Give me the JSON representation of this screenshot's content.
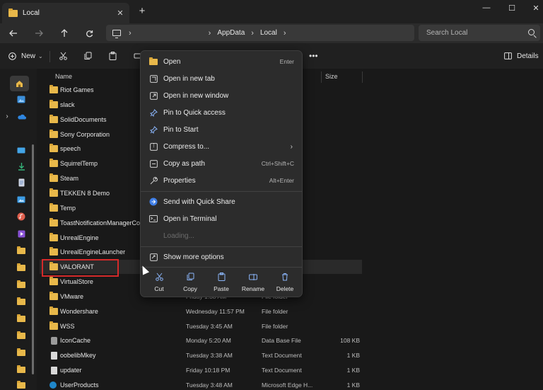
{
  "window": {
    "tab_title": "Local",
    "new_tab": "+",
    "minimize": "—",
    "maximize": "☐",
    "close": "✕"
  },
  "address": {
    "chevron_root": "›",
    "crumbs": [
      "AppData",
      "Local"
    ],
    "sep": "›",
    "search_placeholder": "Search Local"
  },
  "commandbar": {
    "new_label": "New",
    "details_label": "Details",
    "more": "•••"
  },
  "columns": {
    "name": "Name",
    "size": "Size"
  },
  "rows": [
    {
      "name": "Riot Games",
      "date": "",
      "type": "",
      "size": "",
      "icon": "folder"
    },
    {
      "name": "slack",
      "date": "",
      "type": "",
      "size": "",
      "icon": "folder"
    },
    {
      "name": "SolidDocuments",
      "date": "",
      "type": "",
      "size": "",
      "icon": "folder"
    },
    {
      "name": "Sony Corporation",
      "date": "",
      "type": "",
      "size": "",
      "icon": "folder"
    },
    {
      "name": "speech",
      "date": "",
      "type": "",
      "size": "",
      "icon": "folder"
    },
    {
      "name": "SquirrelTemp",
      "date": "",
      "type": "",
      "size": "",
      "icon": "folder"
    },
    {
      "name": "Steam",
      "date": "",
      "type": "",
      "size": "",
      "icon": "folder"
    },
    {
      "name": "TEKKEN 8 Demo",
      "date": "",
      "type": "",
      "size": "",
      "icon": "folder"
    },
    {
      "name": "Temp",
      "date": "",
      "type": "",
      "size": "",
      "icon": "folder"
    },
    {
      "name": "ToastNotificationManagerCo",
      "date": "",
      "type": "",
      "size": "",
      "icon": "folder"
    },
    {
      "name": "UnrealEngine",
      "date": "",
      "type": "",
      "size": "",
      "icon": "folder"
    },
    {
      "name": "UnrealEngineLauncher",
      "date": "",
      "type": "",
      "size": "",
      "icon": "folder"
    },
    {
      "name": "VALORANT",
      "date": "",
      "type": "",
      "size": "",
      "icon": "folder"
    },
    {
      "name": "VirtualStore",
      "date": "",
      "type": "",
      "size": "",
      "icon": "folder"
    },
    {
      "name": "VMware",
      "date": "Friday 1:38 AM",
      "type": "File folder",
      "size": "",
      "icon": "folder"
    },
    {
      "name": "Wondershare",
      "date": "Wednesday 11:57 PM",
      "type": "File folder",
      "size": "",
      "icon": "folder"
    },
    {
      "name": "WSS",
      "date": "Tuesday 3:45 AM",
      "type": "File folder",
      "size": "",
      "icon": "folder"
    },
    {
      "name": "IconCache",
      "date": "Monday 5:20 AM",
      "type": "Data Base File",
      "size": "108 KB",
      "icon": "db"
    },
    {
      "name": "oobelibMkey",
      "date": "Tuesday 3:38 AM",
      "type": "Text Document",
      "size": "1 KB",
      "icon": "file"
    },
    {
      "name": "updater",
      "date": "Friday 10:18 PM",
      "type": "Text Document",
      "size": "1 KB",
      "icon": "file"
    },
    {
      "name": "UserProducts",
      "date": "Tuesday 3:48 AM",
      "type": "Microsoft Edge H...",
      "size": "1 KB",
      "icon": "edge"
    }
  ],
  "context_menu": {
    "items": [
      {
        "label": "Open",
        "shortcut": "Enter"
      },
      {
        "label": "Open in new tab",
        "shortcut": ""
      },
      {
        "label": "Open in new window",
        "shortcut": ""
      },
      {
        "label": "Pin to Quick access",
        "shortcut": ""
      },
      {
        "label": "Pin to Start",
        "shortcut": ""
      },
      {
        "label": "Compress to...",
        "shortcut": "›"
      },
      {
        "label": "Copy as path",
        "shortcut": "Ctrl+Shift+C"
      },
      {
        "label": "Properties",
        "shortcut": "Alt+Enter"
      },
      {
        "label": "Send with Quick Share",
        "shortcut": ""
      },
      {
        "label": "Open in Terminal",
        "shortcut": ""
      },
      {
        "label": "Loading...",
        "shortcut": ""
      },
      {
        "label": "Show more options",
        "shortcut": ""
      }
    ],
    "actions": [
      "Cut",
      "Copy",
      "Paste",
      "Rename",
      "Delete"
    ]
  },
  "colors": {
    "folder": "#e8b84a",
    "accent": "#8ab4f8",
    "highlight_border": "#d42a2a"
  }
}
